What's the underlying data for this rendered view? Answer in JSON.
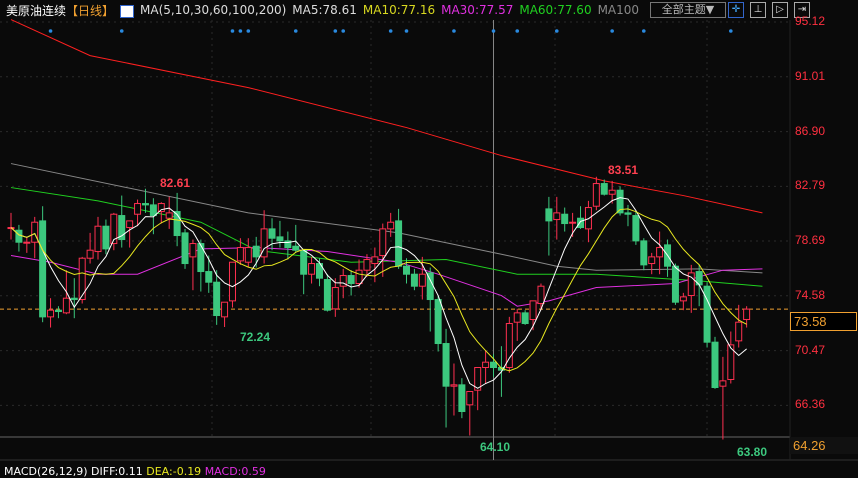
{
  "header": {
    "title": "美原油连续",
    "period": "【日线】",
    "ma_label": "MA(5,10,30,60,100,200)",
    "ma5": "MA5:78.61",
    "ma10": "MA10:77.16",
    "ma30": "MA30:77.57",
    "ma60": "MA60:77.60",
    "ma100": "MA100",
    "topic_button": "全部主题▼"
  },
  "toolbar": [
    "crosshair",
    "range",
    "play",
    "exit"
  ],
  "axis_labels": [
    "95.12",
    "91.01",
    "86.90",
    "82.79",
    "78.69",
    "74.58",
    "70.47",
    "66.36"
  ],
  "last_price": "73.58",
  "low_bound": "64.26",
  "annotations": {
    "high1": "82.61",
    "low1": "72.24",
    "high2": "83.51",
    "low2": "64.10",
    "low3": "63.80"
  },
  "macd_line": {
    "name": "MACD(26,12,9)",
    "diff": "DIFF:0.11",
    "dea": "DEA:-0.19",
    "macd": "MACD:0.59"
  },
  "colors": {
    "up": "#ff3050",
    "down": "#3cc87e",
    "ma5": "#ffffff",
    "ma10": "#e8e820",
    "ma30": "#e030e0",
    "ma60": "#20d020",
    "ma100": "#888888",
    "ma200": "#ff2020"
  },
  "chart_data": {
    "type": "candlestick",
    "ylim": [
      64.26,
      95.12
    ],
    "last": 73.58,
    "crosshair_index": 61,
    "markers": [
      5,
      14,
      28,
      29,
      30,
      36,
      41,
      42,
      48,
      50,
      56,
      61,
      64,
      69,
      76,
      80,
      91
    ],
    "candles_ohlc": [
      [
        79.7,
        80.8,
        78.8,
        79.7
      ],
      [
        79.5,
        79.9,
        77.9,
        78.6
      ],
      [
        78.6,
        79.0,
        77.8,
        78.6
      ],
      [
        78.6,
        80.5,
        77.4,
        80.1
      ],
      [
        80.2,
        81.3,
        72.6,
        73.0
      ],
      [
        73.0,
        74.4,
        72.2,
        73.5
      ],
      [
        73.5,
        73.8,
        72.9,
        73.4
      ],
      [
        73.3,
        76.5,
        73.2,
        74.4
      ],
      [
        74.4,
        75.9,
        72.9,
        74.3
      ],
      [
        74.3,
        77.5,
        74.0,
        77.4
      ],
      [
        77.4,
        79.3,
        77.0,
        78.0
      ],
      [
        77.9,
        80.5,
        77.3,
        79.8
      ],
      [
        79.8,
        80.3,
        77.7,
        78.1
      ],
      [
        78.5,
        80.8,
        78.0,
        80.7
      ],
      [
        80.6,
        82.1,
        78.2,
        78.8
      ],
      [
        79.7,
        80.2,
        78.2,
        80.2
      ],
      [
        80.7,
        81.8,
        79.8,
        81.5
      ],
      [
        81.5,
        82.61,
        80.8,
        81.4
      ],
      [
        81.4,
        81.9,
        79.2,
        80.6
      ],
      [
        80.9,
        81.6,
        80.0,
        81.5
      ],
      [
        80.4,
        82.0,
        79.6,
        80.8
      ],
      [
        80.9,
        82.3,
        78.3,
        79.1
      ],
      [
        79.3,
        79.6,
        76.6,
        77.0
      ],
      [
        77.5,
        78.8,
        75.0,
        78.5
      ],
      [
        78.5,
        78.8,
        74.9,
        76.4
      ],
      [
        76.4,
        77.6,
        74.8,
        75.6
      ],
      [
        75.6,
        76.5,
        72.4,
        73.1
      ],
      [
        73.0,
        73.9,
        72.24,
        74.1
      ],
      [
        74.2,
        76.5,
        73.7,
        77.1
      ],
      [
        77.2,
        78.9,
        76.9,
        78.2
      ],
      [
        77.1,
        78.9,
        76.7,
        78.2
      ],
      [
        78.3,
        79.0,
        76.7,
        77.5
      ],
      [
        77.5,
        81.0,
        77.0,
        79.6
      ],
      [
        79.6,
        80.4,
        78.0,
        78.9
      ],
      [
        79.0,
        80.2,
        78.2,
        78.7
      ],
      [
        78.7,
        79.4,
        77.3,
        78.2
      ],
      [
        78.3,
        79.9,
        77.8,
        78.0
      ],
      [
        78.0,
        78.1,
        74.7,
        76.2
      ],
      [
        76.2,
        77.5,
        75.5,
        77.0
      ],
      [
        77.0,
        77.4,
        75.3,
        75.9
      ],
      [
        75.8,
        76.2,
        73.4,
        73.5
      ],
      [
        73.6,
        75.9,
        73.0,
        75.2
      ],
      [
        75.3,
        76.6,
        74.4,
        76.1
      ],
      [
        76.1,
        76.5,
        74.6,
        75.5
      ],
      [
        75.5,
        77.3,
        75.2,
        76.5
      ],
      [
        76.5,
        77.7,
        76.0,
        77.3
      ],
      [
        77.0,
        78.2,
        75.6,
        77.5
      ],
      [
        77.6,
        80.0,
        76.0,
        79.6
      ],
      [
        79.6,
        80.8,
        79.0,
        80.1
      ],
      [
        80.2,
        81.1,
        76.6,
        76.8
      ],
      [
        76.8,
        77.4,
        75.5,
        76.2
      ],
      [
        76.2,
        76.6,
        75.0,
        75.3
      ],
      [
        75.3,
        77.5,
        74.3,
        76.2
      ],
      [
        76.3,
        76.7,
        71.9,
        74.3
      ],
      [
        74.3,
        74.6,
        70.4,
        71.0
      ],
      [
        71.0,
        72.1,
        64.7,
        67.8
      ],
      [
        67.8,
        69.5,
        65.6,
        67.9
      ],
      [
        67.9,
        68.4,
        65.4,
        65.9
      ],
      [
        66.4,
        67.3,
        64.1,
        67.4
      ],
      [
        67.5,
        68.8,
        66.0,
        69.2
      ],
      [
        69.2,
        70.5,
        68.0,
        69.6
      ],
      [
        69.6,
        70.2,
        68.5,
        69.2
      ],
      [
        69.2,
        70.8,
        67.0,
        69.0
      ],
      [
        69.2,
        73.0,
        68.8,
        72.5
      ],
      [
        72.6,
        73.6,
        71.2,
        73.3
      ],
      [
        73.3,
        73.5,
        72.4,
        72.5
      ],
      [
        72.8,
        73.9,
        72.0,
        74.2
      ],
      [
        74.0,
        75.5,
        73.5,
        75.3
      ],
      [
        81.1,
        82.0,
        77.6,
        80.2
      ],
      [
        80.3,
        82.0,
        78.8,
        80.8
      ],
      [
        80.7,
        81.2,
        79.4,
        80.0
      ],
      [
        80.1,
        80.8,
        79.0,
        80.1
      ],
      [
        80.4,
        81.3,
        79.6,
        79.7
      ],
      [
        79.6,
        81.7,
        78.6,
        81.2
      ],
      [
        81.3,
        83.51,
        81.0,
        83.0
      ],
      [
        83.0,
        83.3,
        82.1,
        82.2
      ],
      [
        82.2,
        83.2,
        81.5,
        82.5
      ],
      [
        82.5,
        82.8,
        80.6,
        80.8
      ],
      [
        80.8,
        81.4,
        79.8,
        80.7
      ],
      [
        80.6,
        80.9,
        78.4,
        78.7
      ],
      [
        78.7,
        78.9,
        76.5,
        76.9
      ],
      [
        77.0,
        77.8,
        76.2,
        77.5
      ],
      [
        77.5,
        79.4,
        76.2,
        78.2
      ],
      [
        78.4,
        78.8,
        76.0,
        76.8
      ],
      [
        76.8,
        77.0,
        73.9,
        74.1
      ],
      [
        74.2,
        74.8,
        73.5,
        74.5
      ],
      [
        74.6,
        76.9,
        73.3,
        76.3
      ],
      [
        76.4,
        76.9,
        73.8,
        75.4
      ],
      [
        75.3,
        75.6,
        70.7,
        71.1
      ],
      [
        71.1,
        71.5,
        67.6,
        67.7
      ],
      [
        67.8,
        70.0,
        63.8,
        68.2
      ],
      [
        68.3,
        71.9,
        68.0,
        70.9
      ],
      [
        71.2,
        73.9,
        70.7,
        72.6
      ],
      [
        72.8,
        73.8,
        72.2,
        73.58
      ]
    ],
    "ma_long": {
      "ma30": [
        [
          0,
          77.6
        ],
        [
          5,
          77.1
        ],
        [
          11,
          76.2
        ],
        [
          16,
          76.2
        ],
        [
          24,
          78.1
        ],
        [
          31,
          78.2
        ],
        [
          40,
          77.9
        ],
        [
          49,
          77.1
        ],
        [
          54,
          76.2
        ],
        [
          62,
          74.6
        ],
        [
          64,
          73.8
        ],
        [
          68,
          74.2
        ],
        [
          74,
          75.2
        ],
        [
          84,
          75.5
        ],
        [
          90,
          76.5
        ],
        [
          95,
          76.6
        ]
      ],
      "ma60": [
        [
          0,
          82.7
        ],
        [
          11,
          81.7
        ],
        [
          24,
          80.1
        ],
        [
          31,
          78.0
        ],
        [
          43,
          77.1
        ],
        [
          55,
          77.3
        ],
        [
          64,
          76.2
        ],
        [
          74,
          76.2
        ],
        [
          87,
          75.7
        ],
        [
          95,
          75.3
        ]
      ],
      "ma100": [
        [
          0,
          84.5
        ],
        [
          30,
          80.8
        ],
        [
          49,
          79.3
        ],
        [
          62,
          77.7
        ],
        [
          69,
          76.8
        ],
        [
          74,
          76.5
        ],
        [
          87,
          76.6
        ],
        [
          95,
          76.3
        ]
      ],
      "ma200": [
        [
          0,
          95.3
        ],
        [
          10,
          92.6
        ],
        [
          30,
          90.2
        ],
        [
          50,
          87.2
        ],
        [
          62,
          85.1
        ],
        [
          75,
          83.2
        ],
        [
          85,
          82.1
        ],
        [
          95,
          80.8
        ]
      ]
    }
  }
}
